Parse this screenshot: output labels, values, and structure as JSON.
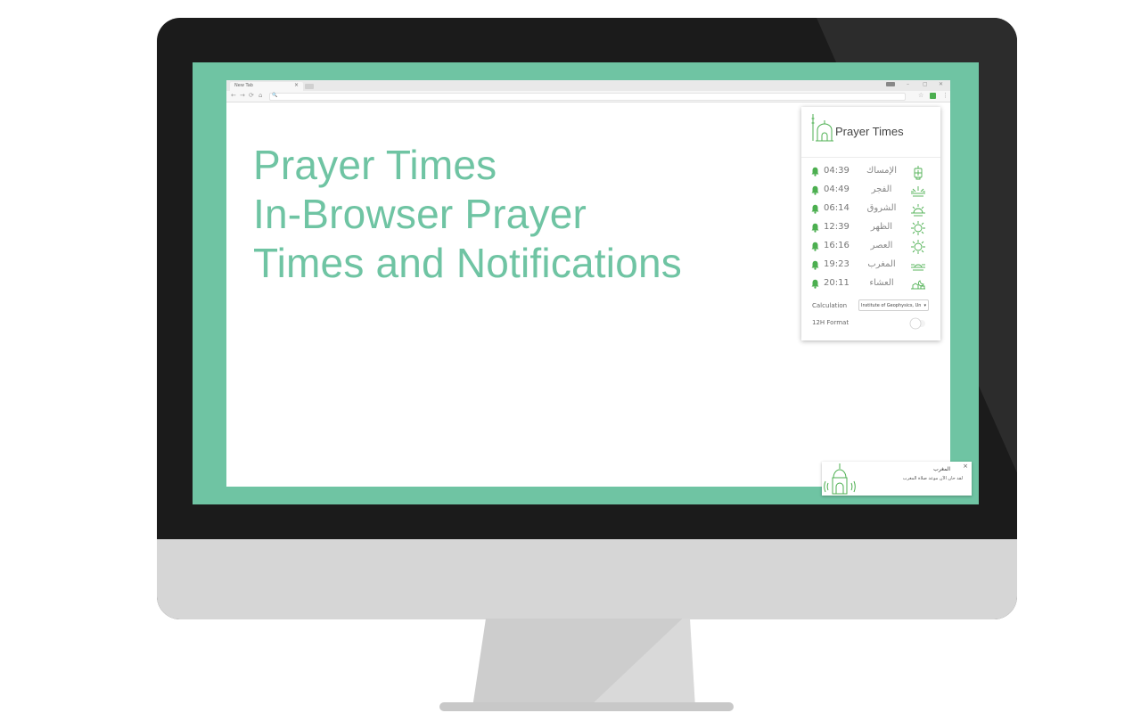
{
  "browser": {
    "tab_title": "New Tab",
    "tab_close": "×",
    "window_controls": [
      "–",
      "▢",
      "✕"
    ],
    "nav": [
      "←",
      "→",
      "⟳",
      "⌂"
    ],
    "search_glyph": "🔍",
    "star_glyph": "☆",
    "menu_glyph": "⋮"
  },
  "hero": {
    "line1": "Prayer Times",
    "line2": "In-Browser Prayer",
    "line3": "Times and Notifications"
  },
  "popup": {
    "title": "Prayer Times",
    "prayers": [
      {
        "time": "04:39",
        "name": "الإمساك",
        "icon": "lantern-icon"
      },
      {
        "time": "04:49",
        "name": "الفجر",
        "icon": "dawn-icon"
      },
      {
        "time": "06:14",
        "name": "الشروق",
        "icon": "sunrise-icon"
      },
      {
        "time": "12:39",
        "name": "الظهر",
        "icon": "sun-icon"
      },
      {
        "time": "16:16",
        "name": "العصر",
        "icon": "sun-icon"
      },
      {
        "time": "19:23",
        "name": "المغرب",
        "icon": "sunset-icon"
      },
      {
        "time": "20:11",
        "name": "العشاء",
        "icon": "moon-icon"
      }
    ],
    "calculation_label": "Calculation",
    "calculation_value": "Institute of Geophysics, Un",
    "calculation_arrow": "▾",
    "format_label": "12H Format",
    "format_12h": false
  },
  "notification": {
    "title": "المغرب",
    "body": "لقد حان الآن موعد صلاة المغرب",
    "close": "×"
  },
  "colors": {
    "accent": "#6fc4a3",
    "icon_green": "#4caf50"
  }
}
